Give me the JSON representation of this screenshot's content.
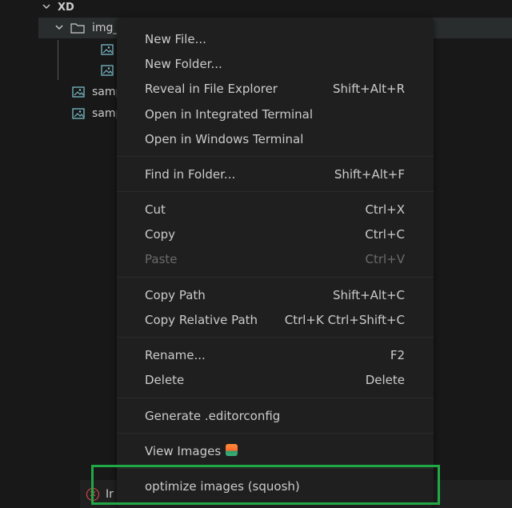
{
  "explorer": {
    "section_title": "XD",
    "folder_name": "img_",
    "files": [
      "samp",
      "samp"
    ]
  },
  "notification": {
    "text": "Ir"
  },
  "menu": {
    "items": [
      {
        "label": "New File...",
        "shortcut": ""
      },
      {
        "label": "New Folder...",
        "shortcut": ""
      },
      {
        "label": "Reveal in File Explorer",
        "shortcut": "Shift+Alt+R"
      },
      {
        "label": "Open in Integrated Terminal",
        "shortcut": ""
      },
      {
        "label": "Open in Windows Terminal",
        "shortcut": ""
      },
      {
        "label": "Find in Folder...",
        "shortcut": "Shift+Alt+F"
      },
      {
        "label": "Cut",
        "shortcut": "Ctrl+X"
      },
      {
        "label": "Copy",
        "shortcut": "Ctrl+C"
      },
      {
        "label": "Paste",
        "shortcut": "Ctrl+V"
      },
      {
        "label": "Copy Path",
        "shortcut": "Shift+Alt+C"
      },
      {
        "label": "Copy Relative Path",
        "shortcut": "Ctrl+K Ctrl+Shift+C"
      },
      {
        "label": "Rename...",
        "shortcut": "F2"
      },
      {
        "label": "Delete",
        "shortcut": "Delete"
      },
      {
        "label": "Generate .editorconfig",
        "shortcut": ""
      },
      {
        "label": "View Images",
        "shortcut": ""
      },
      {
        "label": "optimize images (squosh)",
        "shortcut": ""
      }
    ]
  },
  "colors": {
    "highlight": "#21a846",
    "menu_bg": "#1f1f1f",
    "disabled_text": "#6b6b6b",
    "error": "#f14c4c"
  }
}
